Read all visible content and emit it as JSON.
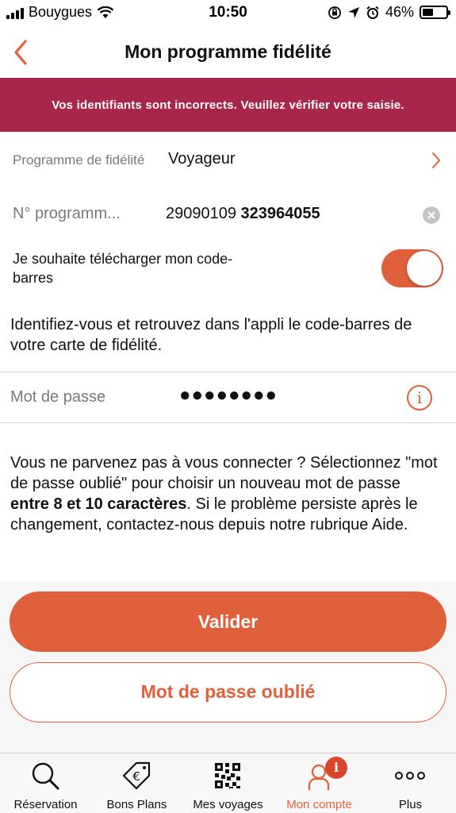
{
  "status_bar": {
    "carrier": "Bouygues",
    "time": "10:50",
    "battery": "46%",
    "battery_level": 0.46
  },
  "nav": {
    "title": "Mon programme fidélité",
    "back_icon": "chevron-left-icon"
  },
  "error": {
    "message": "Vos identifiants sont incorrects. Veuillez vérifier votre saisie."
  },
  "form": {
    "program_label": "Programme de fidélité",
    "program_value": "Voyageur",
    "number_label": "N° programm...",
    "number_prefix": "29090109",
    "number_suffix": "323964055",
    "barcode_label": "Je souhaite télécharger mon code-barres",
    "barcode_toggle_on": true,
    "info_text": "Identifiez-vous et retrouvez dans l'appli le code-barres de votre carte de fidélité.",
    "password_label": "Mot de passe",
    "password_value": "●●●●●●●●"
  },
  "help": {
    "part1": "Vous ne parvenez pas à vous connecter ? Sélectionnez \"mot de passe oublié\" pour choisir un nouveau mot de passe ",
    "bold": "entre 8 et 10 caractères",
    "part2": ". Si le problème persiste après le changement, contactez-nous depuis notre rubrique Aide."
  },
  "buttons": {
    "validate": "Valider",
    "forgot_password": "Mot de passe oublié"
  },
  "tabs": [
    {
      "label": "Réservation",
      "icon": "search-icon",
      "active": false
    },
    {
      "label": "Bons Plans",
      "icon": "euro-tag-icon",
      "active": false
    },
    {
      "label": "Mes voyages",
      "icon": "qr-code-icon",
      "active": false
    },
    {
      "label": "Mon compte",
      "icon": "user-icon",
      "active": true,
      "badge": "i"
    },
    {
      "label": "Plus",
      "icon": "more-dots-icon",
      "active": false
    }
  ],
  "colors": {
    "accent": "#e0603c",
    "error_banner": "#a8264a",
    "badge": "#d9462b"
  }
}
